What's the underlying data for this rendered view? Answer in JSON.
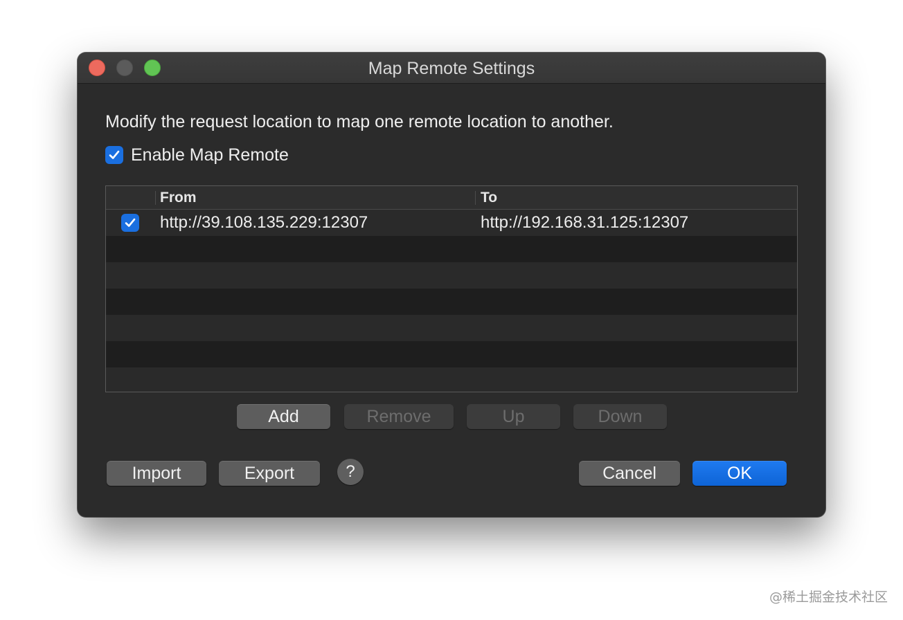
{
  "window": {
    "title": "Map Remote Settings"
  },
  "description": "Modify the request location to map one remote location to another.",
  "enable": {
    "label": "Enable Map Remote",
    "checked": true
  },
  "table": {
    "columns": [
      "",
      "From",
      "To"
    ],
    "rows": [
      {
        "enabled": true,
        "from": "http://39.108.135.229:12307",
        "to": "http://192.168.31.125:12307"
      }
    ]
  },
  "row_buttons": {
    "add": "Add",
    "remove": "Remove",
    "up": "Up",
    "down": "Down"
  },
  "footer": {
    "import": "Import",
    "export": "Export",
    "help": "?",
    "cancel": "Cancel",
    "ok": "OK"
  },
  "watermark": "@稀土掘金技术社区",
  "colors": {
    "accent": "#1a6fe0",
    "window_bg": "#2b2b2b",
    "close": "#ed6a5e",
    "maximize": "#61c454"
  }
}
